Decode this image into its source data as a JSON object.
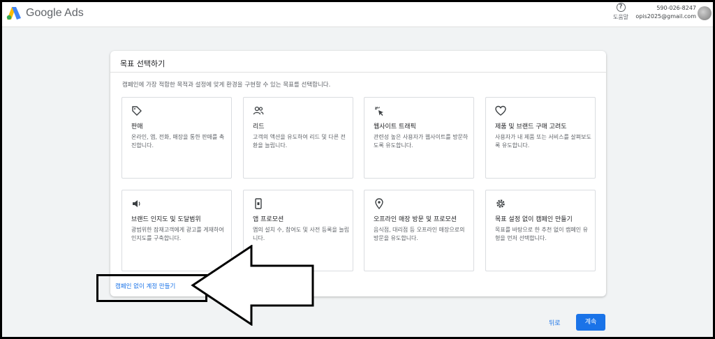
{
  "header": {
    "brand": "Google Ads",
    "help_label": "도움말",
    "help_glyph": "?",
    "account_phone": "590-026-8247",
    "account_email": "opis2025@gmail.com"
  },
  "panel": {
    "title": "목표 선택하기",
    "description": "캠페인에 가장 적합한 목적과 설정에 맞게 환경을 구현할 수 있는 목표를 선택합니다."
  },
  "goals": [
    {
      "icon": "tag-icon",
      "title": "판매",
      "desc": "온라인, 앱, 전화, 매장을 통한 판매를 촉진합니다."
    },
    {
      "icon": "people-icon",
      "title": "리드",
      "desc": "고객의 액션을 유도하여 리드 및 다른 전환을 늘립니다."
    },
    {
      "icon": "cursor-click-icon",
      "title": "웹사이트 트래픽",
      "desc": "관련성 높은 사용자가 웹사이트를 방문하도록 유도합니다."
    },
    {
      "icon": "heart-icon",
      "title": "제품 및 브랜드 구매 고려도",
      "desc": "사용자가 내 제품 또는 서비스를 살펴보도록 유도합니다."
    },
    {
      "icon": "speaker-icon",
      "title": "브랜드 인지도 및 도달범위",
      "desc": "광범위한 잠재고객에게 광고를 게재하여 인지도를 구축합니다."
    },
    {
      "icon": "phone-icon",
      "title": "앱 프로모션",
      "desc": "앱의 설치 수, 참여도 및 사전 등록을 늘립니다."
    },
    {
      "icon": "location-pin-icon",
      "title": "오프라인 매장 방문 및 프로모션",
      "desc": "음식점, 대리점 등 오프라인 매장으로의 방문을 유도합니다."
    },
    {
      "icon": "gear-icon",
      "title": "목표 설정 없이 캠페인 만들기",
      "desc": "목표를 바탕으로 한 추천 없이 캠페인 유형을 먼저 선택합니다."
    }
  ],
  "footer": {
    "account_without_campaign": "캠페인 없이 계정 만들기",
    "back_label": "뒤로",
    "continue_label": "계속"
  },
  "colors": {
    "accent": "#1a73e8",
    "background": "#f1f3f4",
    "annotation": "#000000"
  }
}
